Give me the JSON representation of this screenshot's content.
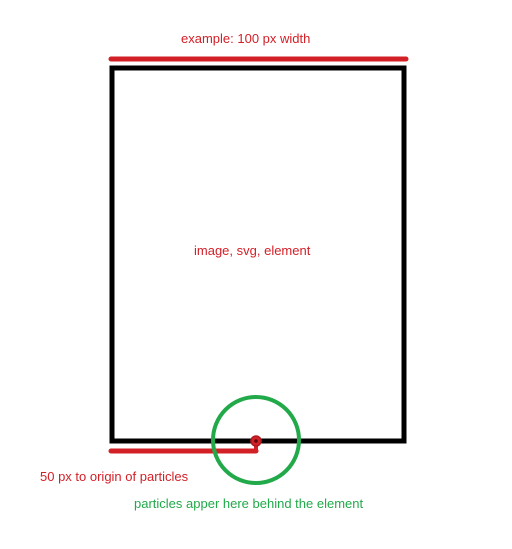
{
  "labels": {
    "width_annotation": "example: 100 px width",
    "element_label": "image, svg, element",
    "offset_annotation": "50 px to origin of particles",
    "particles_note": "particles apper here behind the element"
  },
  "colors": {
    "annotation_red": "#d32027",
    "particles_green": "#22a94a",
    "element_black": "#000000"
  }
}
